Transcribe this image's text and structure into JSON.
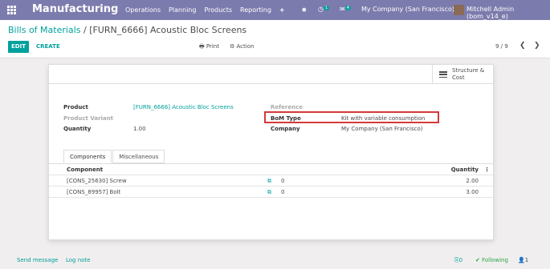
{
  "navbar": {
    "brand": "Manufacturing",
    "menu": [
      "Operations",
      "Planning",
      "Products",
      "Reporting",
      "+"
    ],
    "bug_glyph": "🞿",
    "activity_count": "1",
    "message_count": "4",
    "company": "My Company (San Francisco)",
    "user": "Mitchell Admin (bom_v14_e)"
  },
  "control_panel": {
    "breadcrumb_parent": "Bills of Materials",
    "breadcrumb_sep": "/",
    "breadcrumb_current": "[FURN_6666] Acoustic Bloc Screens",
    "edit_label": "EDIT",
    "create_label": "CREATE",
    "print_label": "Print",
    "action_label": "Action",
    "pager": "9 / 9"
  },
  "button_box": {
    "structure_line1": "Structure &",
    "structure_line2": "Cost"
  },
  "form": {
    "product_label": "Product",
    "product_value": "[FURN_6666] Acoustic Bloc Screens",
    "variant_label": "Product Variant",
    "quantity_label": "Quantity",
    "quantity_value": "1.00",
    "reference_label": "Reference",
    "bom_type_label": "BoM Type",
    "bom_type_value": "Kit with variable consumption",
    "company_label": "Company",
    "company_value": "My Company (San Francisco)"
  },
  "tabs": [
    "Components",
    "Miscellaneous"
  ],
  "components": {
    "headers": {
      "component": "Component",
      "quantity": "Quantity"
    },
    "rows": [
      {
        "component": "[CONS_25630] Screw",
        "mid": "0",
        "quantity": "2.00"
      },
      {
        "component": "[CONS_89957] Bolt",
        "mid": "0",
        "quantity": "3.00"
      }
    ]
  },
  "chatter": {
    "send_message": "Send message",
    "log_note": "Log note",
    "attachments": "0",
    "following": "Following",
    "followers": "1"
  },
  "colors": {
    "navbar": "#7c7bad",
    "accent": "#00a09d",
    "highlight": "#d43a3a"
  }
}
